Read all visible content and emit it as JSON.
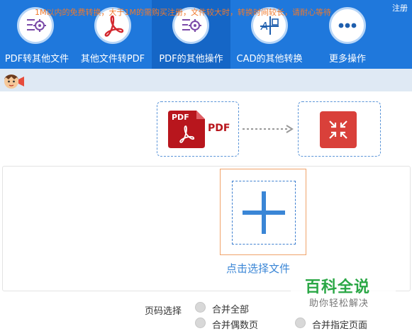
{
  "header": {
    "register_label": "注册",
    "nav": [
      {
        "label": "PDF转其他文件",
        "icon": "settings-doc-icon"
      },
      {
        "label": "其他文件转PDF",
        "icon": "pdf-logo-icon"
      },
      {
        "label": "PDF的其他操作",
        "icon": "settings-doc-icon",
        "active": true
      },
      {
        "label": "CAD的其他转换",
        "icon": "cad-icon"
      },
      {
        "label": "更多操作",
        "icon": "more-dots-icon"
      }
    ]
  },
  "notice": {
    "text": "1M以内的免费转换，大于1M的需购买注册，文件较大时，转换时间较长，请耐心等待"
  },
  "conversion": {
    "source_badge": "PDF",
    "source_label": "PDF",
    "target_icon": "compress-icon"
  },
  "upload": {
    "choose_label": "点击选择文件"
  },
  "options": {
    "page_select_label": "页码选择",
    "choices": [
      "合并全部",
      "合并偶数页",
      "合并指定页面"
    ]
  },
  "watermark": {
    "title": "百科全说",
    "subtitle": "助你轻松解决"
  },
  "colors": {
    "header_bg": "#1f78dc",
    "active_tab": "#1566c6",
    "notice_text": "#f0792c",
    "accent_blue": "#3a86d6",
    "pdf_red": "#b8161d",
    "compress_red": "#d9403a",
    "watermark_green": "#2aa745"
  }
}
